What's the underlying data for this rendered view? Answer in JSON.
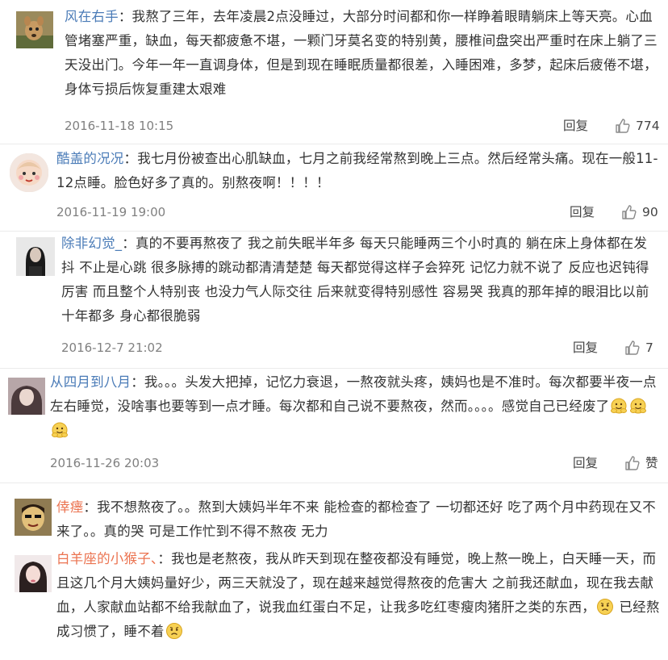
{
  "comments": [
    {
      "user": "风在右手",
      "colon": "：",
      "text": "我熬了三年，去年凌晨2点没睡过，大部分时间都和你一样睁着眼睛躺床上等天亮。心血管堵塞严重，缺血，每天都疲惫不堪，一颗门牙莫名变的特别黄，腰椎间盘突出严重时在床上躺了三天没出门。今年一年一直调身体，但是到现在睡眠质量都很差，入睡困难，多梦，起床后疲倦不堪，身体亏损后恢复重建太艰难",
      "time": "2016-11-18 10:15",
      "reply": "回复",
      "likes": "774"
    },
    {
      "user": "酷盖的况况",
      "colon": "：",
      "text": "我七月份被查出心肌缺血，七月之前我经常熬到晚上三点。然后经常头痛。现在一般11-12点睡。脸色好多了真的。别熬夜啊！！！！",
      "time": "2016-11-19 19:00",
      "reply": "回复",
      "likes": "90"
    },
    {
      "user": "除非幻觉_",
      "colon": "：",
      "text": "真的不要再熬夜了 我之前失眠半年多 每天只能睡两三个小时真的 躺在床上身体都在发抖 不止是心跳 很多脉搏的跳动都清清楚楚 每天都觉得这样子会猝死 记忆力就不说了 反应也迟钝得厉害 而且整个人特别丧 也没力气人际交往 后来就变得特别感性 容易哭 我真的那年掉的眼泪比以前十年都多 身心都很脆弱",
      "time": "2016-12-7 21:02",
      "reply": "回复",
      "likes": "7"
    },
    {
      "user": "从四月到八月",
      "colon": "：",
      "text": "我。。。头发大把掉，记忆力衰退，一熬夜就头疼，姨妈也是不准时。每次都要半夜一点左右睡觉，没啥事也要等到一点才睡。每次都和自己说不要熬夜，然而。。。。感觉自己已经废了",
      "emoji": [
        "hug-emoji",
        "hug-emoji",
        "hug-emoji"
      ],
      "time": "2016-11-26 20:03",
      "reply": "回复",
      "likes": "赞"
    },
    {
      "user": "倖瘗",
      "colon": "：",
      "text": "我不想熬夜了。。熬到大姨妈半年不来 能检查的都检查了 一切都还好 吃了两个月中药现在又不来了。。真的哭 可是工作忙到不得不熬夜 无力"
    },
    {
      "user": "白羊座的小猴子、",
      "colon": "：",
      "text_a": "我也是老熬夜，我从昨天到现在整夜都没有睡觉，晚上熬一晚上，白天睡一天，而且这几个月大姨妈量好少，两三天就没了，现在越来越觉得熬夜的危害大 之前我还献血，现在我去献血，人家献血站都不给我献血了，说我血红蛋白不足，让我多吃红枣瘦肉猪肝之类的东西，",
      "text_b": " 已经熬成习惯了，睡不着",
      "emoji_a": "sad-emoji",
      "emoji_b": "sad-emoji"
    }
  ],
  "colors": {
    "username_orange": "#eb7350",
    "username_blue": "#4a7bb7",
    "text": "#333333",
    "time": "#808080"
  }
}
